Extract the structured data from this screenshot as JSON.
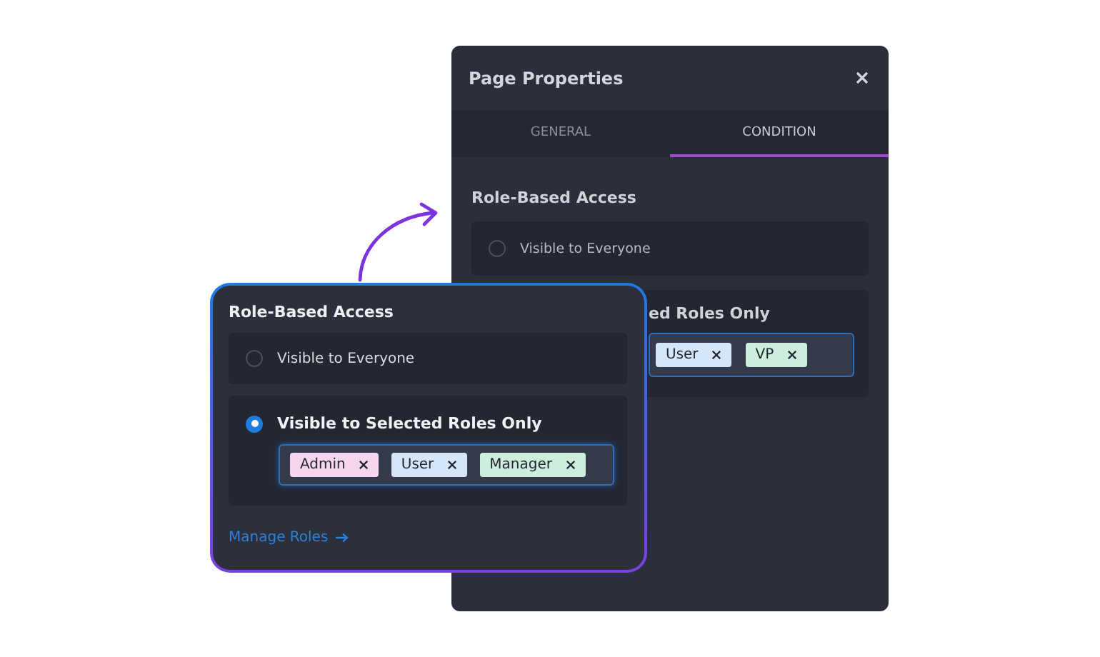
{
  "back_panel": {
    "title": "Page Properties",
    "tabs": [
      {
        "label": "GENERAL",
        "selected": false
      },
      {
        "label": "CONDITION",
        "selected": true
      }
    ],
    "section_title": "Role-Based Access",
    "options": [
      {
        "label": "Visible to Everyone",
        "selected": false
      },
      {
        "label": "ed Roles Only",
        "roles": [
          {
            "label": "User",
            "color": "#d4e6f7"
          },
          {
            "label": "VP",
            "color": "#cdeedd"
          }
        ]
      }
    ]
  },
  "card": {
    "section_title": "Role-Based Access",
    "options": [
      {
        "label": "Visible to Everyone",
        "selected": false
      },
      {
        "label": "Visible to Selected Roles Only",
        "selected": true,
        "roles": [
          {
            "label": "Admin",
            "color": "#f6d5ef"
          },
          {
            "label": "User",
            "color": "#d4e6f7"
          },
          {
            "label": "Manager",
            "color": "#cdeedd"
          }
        ]
      }
    ],
    "link": "Manage Roles"
  }
}
